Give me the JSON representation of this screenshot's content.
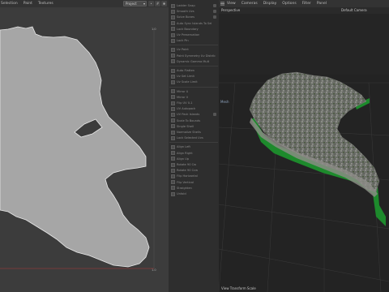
{
  "uv_editor": {
    "menu": [
      "Selection",
      "Paint",
      "Textures"
    ],
    "project_dropdown": "Project",
    "colors": {
      "background": "#3c3c3c",
      "island_fill": "#a6a6a6",
      "island_stroke": "#e8e8e8",
      "boundary": "#8a3a3a"
    }
  },
  "properties": {
    "groups": [
      {
        "rows": [
          {
            "label": "Ladder Snap"
          },
          {
            "label": "Smooth Uvs"
          },
          {
            "label": "Solve Bones"
          },
          {
            "label": "Auto Sync Islands To Sel"
          },
          {
            "label": "Lock Boundary"
          },
          {
            "label": "Uv Preservation"
          },
          {
            "label": "Lock Pin"
          }
        ]
      },
      {
        "rows": [
          {
            "label": "Uv Paint"
          },
          {
            "label": "Paint Symmetry Uv Distrib"
          },
          {
            "label": "Dynamic Gamma Mult"
          }
        ]
      },
      {
        "rows": [
          {
            "label": "Auto Flatten"
          },
          {
            "label": "Uv Set Limit"
          },
          {
            "label": "Uv Scale Limit"
          }
        ]
      },
      {
        "rows": [
          {
            "label": "Mirror U"
          },
          {
            "label": "Mirror V"
          },
          {
            "label": "Flip UV 0-1"
          },
          {
            "label": "UV Autopack"
          },
          {
            "label": "UV Pack Islands"
          },
          {
            "label": "Scale To Bounds"
          },
          {
            "label": "Single Shell"
          },
          {
            "label": "Normalize Shells"
          },
          {
            "label": "Lock Selected Uvs"
          }
        ]
      },
      {
        "rows": [
          {
            "label": "Align Left"
          },
          {
            "label": "Align Right"
          },
          {
            "label": "Align Up"
          },
          {
            "label": "Rotate 90 Cw"
          },
          {
            "label": "Rotate 90 Ccw"
          },
          {
            "label": "Flip Horizontal"
          },
          {
            "label": "Flip Vertical"
          },
          {
            "label": "Straighten"
          },
          {
            "label": "Unfold"
          }
        ]
      }
    ]
  },
  "viewport": {
    "menu": [
      "View",
      "Cameras",
      "Display",
      "Options",
      "Filter",
      "Panel"
    ],
    "view_mode": "Perspective",
    "camera": "Default Camera",
    "object_name": "Mesh",
    "status": "View Transform Scale",
    "colors": {
      "background": "#232323",
      "grid": "#3a3a3a",
      "terrain": "#6e716a",
      "skirt": "#1d8a2c"
    }
  }
}
